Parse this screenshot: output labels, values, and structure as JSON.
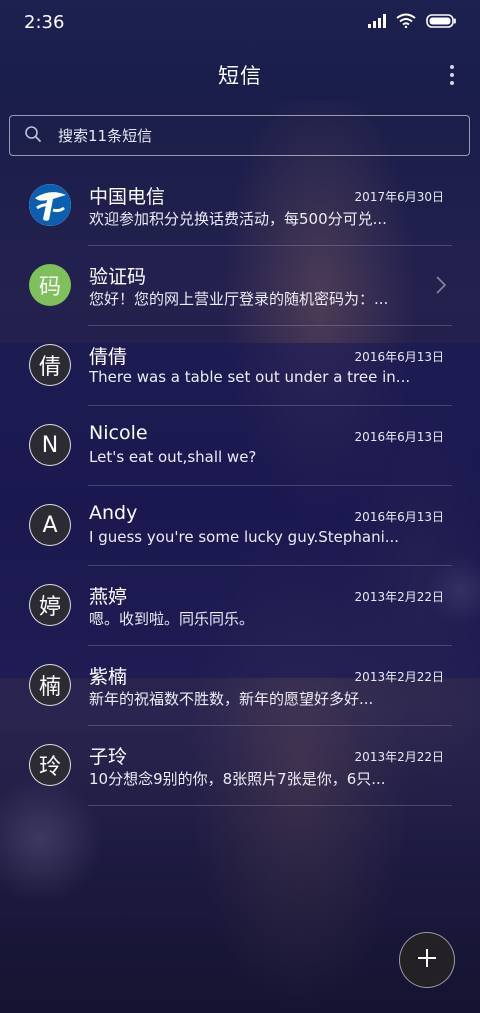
{
  "status_bar": {
    "time": "2:36",
    "icons": [
      "signal-icon",
      "wifi-icon",
      "battery-icon"
    ]
  },
  "header": {
    "title": "短信",
    "menu_icon": "more-vertical-icon"
  },
  "search": {
    "placeholder": "搜索11条短信",
    "icon": "search-icon"
  },
  "conversations": [
    {
      "avatar": "",
      "avatar_type": "china-telecom-logo",
      "name": "中国电信",
      "date": "2017年6月30日",
      "preview": "欢迎参加积分兑换话费活动，每500分可兑..."
    },
    {
      "avatar": "码",
      "avatar_type": "green",
      "name": "验证码",
      "date": "",
      "preview": "您好！您的网上营业厅登录的随机密码为：...",
      "chevron": "chevron-right-icon"
    },
    {
      "avatar": "倩",
      "name": "倩倩",
      "date": "2016年6月13日",
      "preview": "There was a table set out under a tree in..."
    },
    {
      "avatar": "N",
      "name": "Nicole",
      "date": "2016年6月13日",
      "preview": "Let's eat out,shall we?"
    },
    {
      "avatar": "A",
      "name": "Andy",
      "date": "2016年6月13日",
      "preview": "I guess you're some lucky guy.Stephani..."
    },
    {
      "avatar": "婷",
      "name": "燕婷",
      "date": "2013年2月22日",
      "preview": "嗯。收到啦。同乐同乐。"
    },
    {
      "avatar": "楠",
      "name": "紫楠",
      "date": "2013年2月22日",
      "preview": "新年的祝福数不胜数，新年的愿望好多好..."
    },
    {
      "avatar": "玲",
      "name": "子玲",
      "date": "2013年2月22日",
      "preview": "10分想念9别的你，8张照片7张是你，6只..."
    }
  ],
  "fab": {
    "icon": "plus-icon"
  },
  "colors": {
    "avatar_green": "#7ec05a",
    "telecom_blue": "#0a5fb0"
  }
}
